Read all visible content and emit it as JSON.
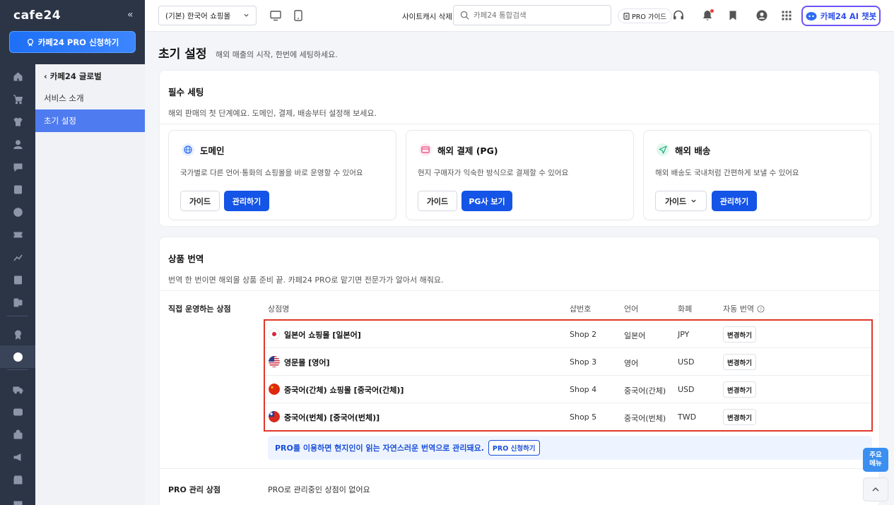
{
  "app": {
    "logo": "cafe24",
    "collapse_icon": "«"
  },
  "sidebar": {
    "pro_button": "카페24 PRO 신청하기",
    "back_label": "카페24 글로벌",
    "items": [
      {
        "label": "서비스 소개",
        "active": false
      },
      {
        "label": "초기 설정",
        "active": true
      }
    ],
    "rail_icons": [
      "home-icon",
      "cart-icon",
      "shirt-icon",
      "user-icon",
      "chat-icon",
      "board-icon",
      "palette-icon",
      "ticket-icon",
      "chart-icon",
      "report-icon",
      "app-icon",
      "pro-badge-icon",
      "global-icon",
      "truck-icon",
      "video-icon",
      "store-icon",
      "megaphone-icon",
      "shop-icon",
      "more-icon"
    ]
  },
  "header": {
    "shop_select": "(기본) 한국어 쇼핑몰",
    "cache_delete": "사이트캐시 삭제",
    "search_placeholder": "카페24 통합검색",
    "pro_guide": "PRO 가이드",
    "ai_chat": "카페24 AI 챗봇"
  },
  "page": {
    "title": "초기 설정",
    "subtitle": "해외 매출의 시작, 한번에 세팅하세요."
  },
  "essential": {
    "title": "필수 세팅",
    "desc": "해외 판매의 첫 단계예요. 도메인, 결제, 배송부터 설정해 보세요.",
    "cards": [
      {
        "title": "도메인",
        "desc": "국가별로 다른 언어·통화의 쇼핑몰을 바로 운영할 수 있어요",
        "guide": "가이드",
        "action": "관리하기",
        "icon": "globe-icon",
        "color": "#2f6ff0"
      },
      {
        "title": "해외 결제 (PG)",
        "desc": "현지 구매자가 익숙한 방식으로 결제할 수 있어요",
        "guide": "가이드",
        "action": "PG사 보기",
        "icon": "card-icon",
        "color": "#e8467c"
      },
      {
        "title": "해외 배송",
        "desc": "해외 배송도 국내처럼 간편하게 보낼 수 있어요",
        "guide": "가이드",
        "action": "관리하기",
        "icon": "plane-icon",
        "color": "#17b07a"
      }
    ]
  },
  "translation": {
    "title": "상품 번역",
    "desc": "번역 한 번이면 해외몰 상품 준비 끝. 카페24 PRO로 맡기면 전문가가 알아서 해줘요.",
    "direct_label": "직접 운영하는 상점",
    "columns": {
      "shop": "상점명",
      "shop_no": "샵번호",
      "language": "언어",
      "currency": "화폐",
      "auto": "자동 번역"
    },
    "rows": [
      {
        "name": "일본어 쇼핑몰 [일본어]",
        "shop_no": "Shop 2",
        "language": "일본어",
        "currency": "JPY",
        "action": "변경하기",
        "flag": "jp"
      },
      {
        "name": "영문몰 [영어]",
        "shop_no": "Shop 3",
        "language": "영어",
        "currency": "USD",
        "action": "변경하기",
        "flag": "us"
      },
      {
        "name": "중국어(간체) 쇼핑몰 [중국어(간체)]",
        "shop_no": "Shop 4",
        "language": "중국어(간체)",
        "currency": "USD",
        "action": "변경하기",
        "flag": "cn"
      },
      {
        "name": "중국어(번체) [중국어(번체)]",
        "shop_no": "Shop 5",
        "language": "중국어(번체)",
        "currency": "TWD",
        "action": "변경하기",
        "flag": "tw"
      }
    ],
    "pro_banner": "PRO를 이용하면 현지인이 읽는 자연스러운 번역으로 관리돼요.",
    "pro_apply": "PRO 신청하기",
    "pro_managed_label": "PRO 관리 상점",
    "pro_managed_empty": "PRO로 관리중인 상점이 없어요"
  },
  "fab": {
    "menu_line1": "주요",
    "menu_line2": "메뉴"
  }
}
